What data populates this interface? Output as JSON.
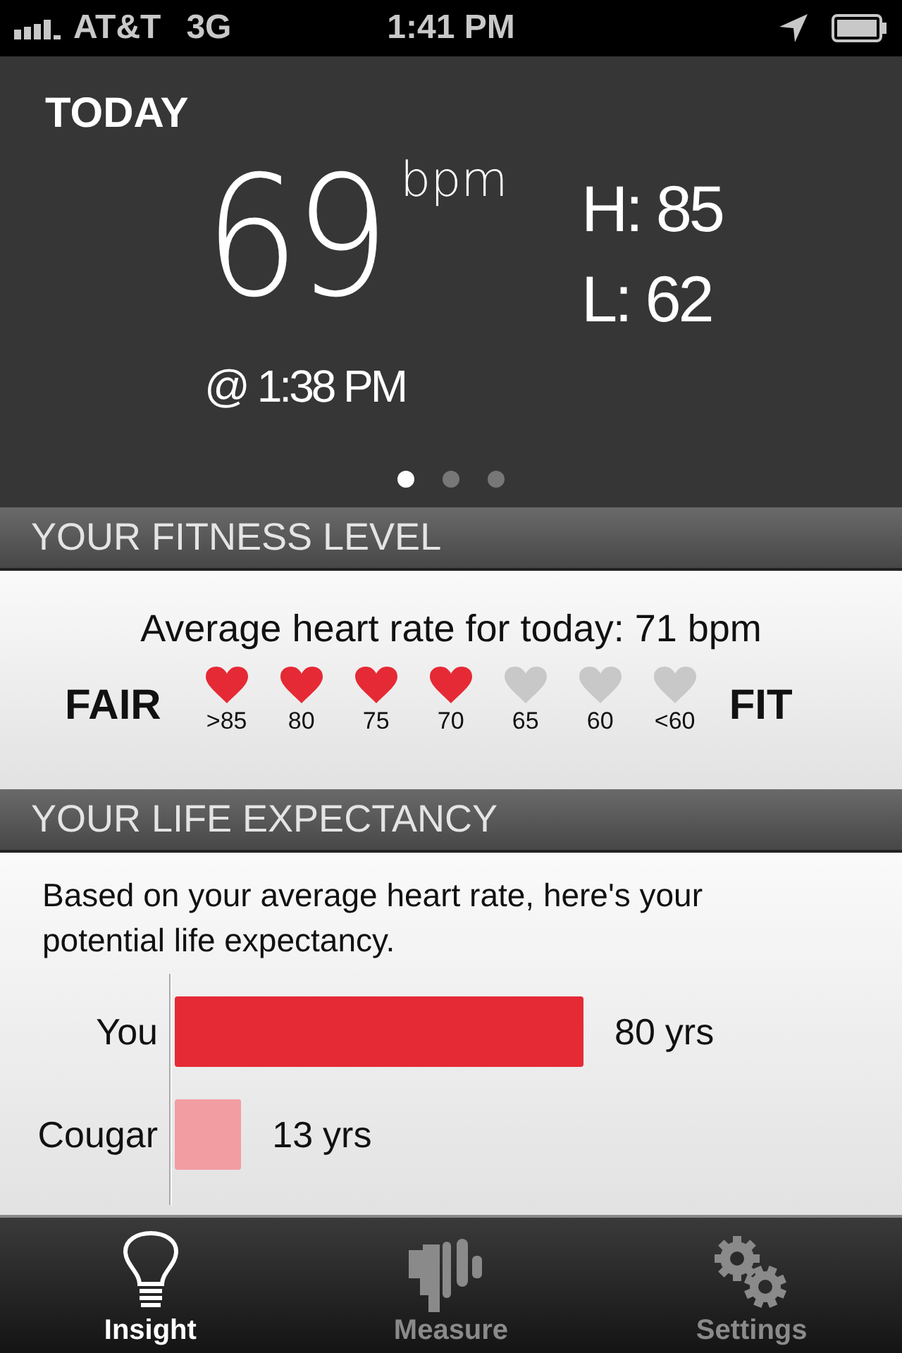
{
  "status_bar": {
    "carrier": "AT&T",
    "network": "3G",
    "time": "1:41 PM"
  },
  "today": {
    "title": "TODAY",
    "value": "69",
    "unit": "bpm",
    "time": "@ 1:38 PM",
    "high": "H: 85",
    "low": "L: 62",
    "pages": [
      {
        "selected": true
      },
      {
        "selected": false
      },
      {
        "selected": false
      }
    ]
  },
  "fitness": {
    "header": "YOUR FITNESS LEVEL",
    "summary": "Average heart rate for today: 71 bpm",
    "low_label": "FAIR",
    "high_label": "FIT",
    "hearts": [
      {
        "label": ">85",
        "filled": true
      },
      {
        "label": "80",
        "filled": true
      },
      {
        "label": "75",
        "filled": true
      },
      {
        "label": "70",
        "filled": true
      },
      {
        "label": "65",
        "filled": false
      },
      {
        "label": "60",
        "filled": false
      },
      {
        "label": "<60",
        "filled": false
      }
    ]
  },
  "life": {
    "header": "YOUR LIFE EXPECTANCY",
    "text": "Based on your average heart rate, here's your potential life expectancy.",
    "chart_data": {
      "type": "bar",
      "orientation": "horizontal",
      "series": [
        {
          "name": "You",
          "color": "#e52a35",
          "values": [
            80
          ]
        },
        {
          "name": "Cougar",
          "color": "#f29da2",
          "values": [
            13
          ]
        }
      ],
      "data_labels": true
    },
    "value_units": [
      "yrs",
      "yrs"
    ]
  },
  "tabs": [
    {
      "label": "Insight",
      "kind": "bulb",
      "selected": true
    },
    {
      "label": "Measure",
      "kind": "heart",
      "selected": false
    },
    {
      "label": "Settings",
      "kind": "gears",
      "selected": false
    }
  ]
}
